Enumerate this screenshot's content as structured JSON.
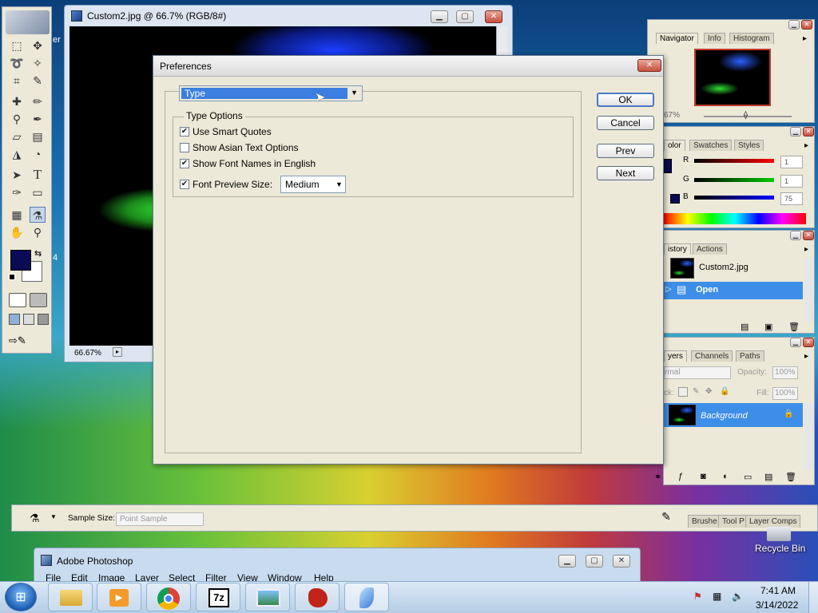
{
  "colors": {
    "highlight": "#3c7fe0",
    "selection": "#3d8ee8",
    "fg_swatch": "#0a0a55",
    "taskbar": "#c9dff2"
  },
  "image_window": {
    "title": "Custom2.jpg @ 66.7% (RGB/8#)",
    "zoom": "66.67%"
  },
  "toolbox": {
    "partial_label": "er",
    "partial_num": "4"
  },
  "preferences": {
    "title": "Preferences",
    "category_dropdown": "Type",
    "group_title": "Type Options",
    "options": [
      {
        "label": "Use Smart Quotes",
        "checked": true
      },
      {
        "label": "Show Asian Text Options",
        "checked": false
      },
      {
        "label": "Show Font Names in English",
        "checked": true
      },
      {
        "label": "Font Preview Size:",
        "checked": true
      }
    ],
    "font_preview_size": "Medium",
    "buttons": {
      "ok": "OK",
      "cancel": "Cancel",
      "prev": "Prev",
      "next": "Next"
    }
  },
  "navigator": {
    "tabs": [
      "Navigator",
      "Info",
      "Histogram"
    ],
    "zoom": "67%"
  },
  "color_panel": {
    "tabs": [
      "olor",
      "Swatches",
      "Styles"
    ],
    "r_label": "R",
    "g_label": "G",
    "b_label": "B",
    "r": "1",
    "g": "1",
    "b": "75"
  },
  "history_panel": {
    "tabs": [
      "istory",
      "Actions"
    ],
    "snapshot": "Custom2.jpg",
    "step": "Open"
  },
  "layers_panel": {
    "tabs": [
      "yers",
      "Channels",
      "Paths"
    ],
    "blend": "rmal",
    "opacity_label": "Opacity:",
    "opacity": "100%",
    "lock_label": "ck:",
    "fill_label": "Fill:",
    "fill": "100%",
    "layer": "Background"
  },
  "options_bar": {
    "sample_size_label": "Sample Size:",
    "sample_size": "Point Sample",
    "well_tabs": [
      "Brushe",
      "Tool P",
      "Layer Comps"
    ]
  },
  "desktop": {
    "recycle_bin": "Recycle Bin"
  },
  "photoshop_bar": {
    "title": "Adobe Photoshop",
    "menu": [
      "File",
      "Edit",
      "Image",
      "Layer",
      "Select",
      "Filter",
      "View",
      "Window",
      "Help"
    ]
  },
  "taskbar": {
    "time": "7:41 AM",
    "date": "3/14/2022",
    "icons": [
      "explorer-icon",
      "media-player-icon",
      "chrome-icon",
      "7zip-icon",
      "photo-viewer-icon",
      "app-red-icon",
      "photoshop-feather-icon"
    ]
  }
}
